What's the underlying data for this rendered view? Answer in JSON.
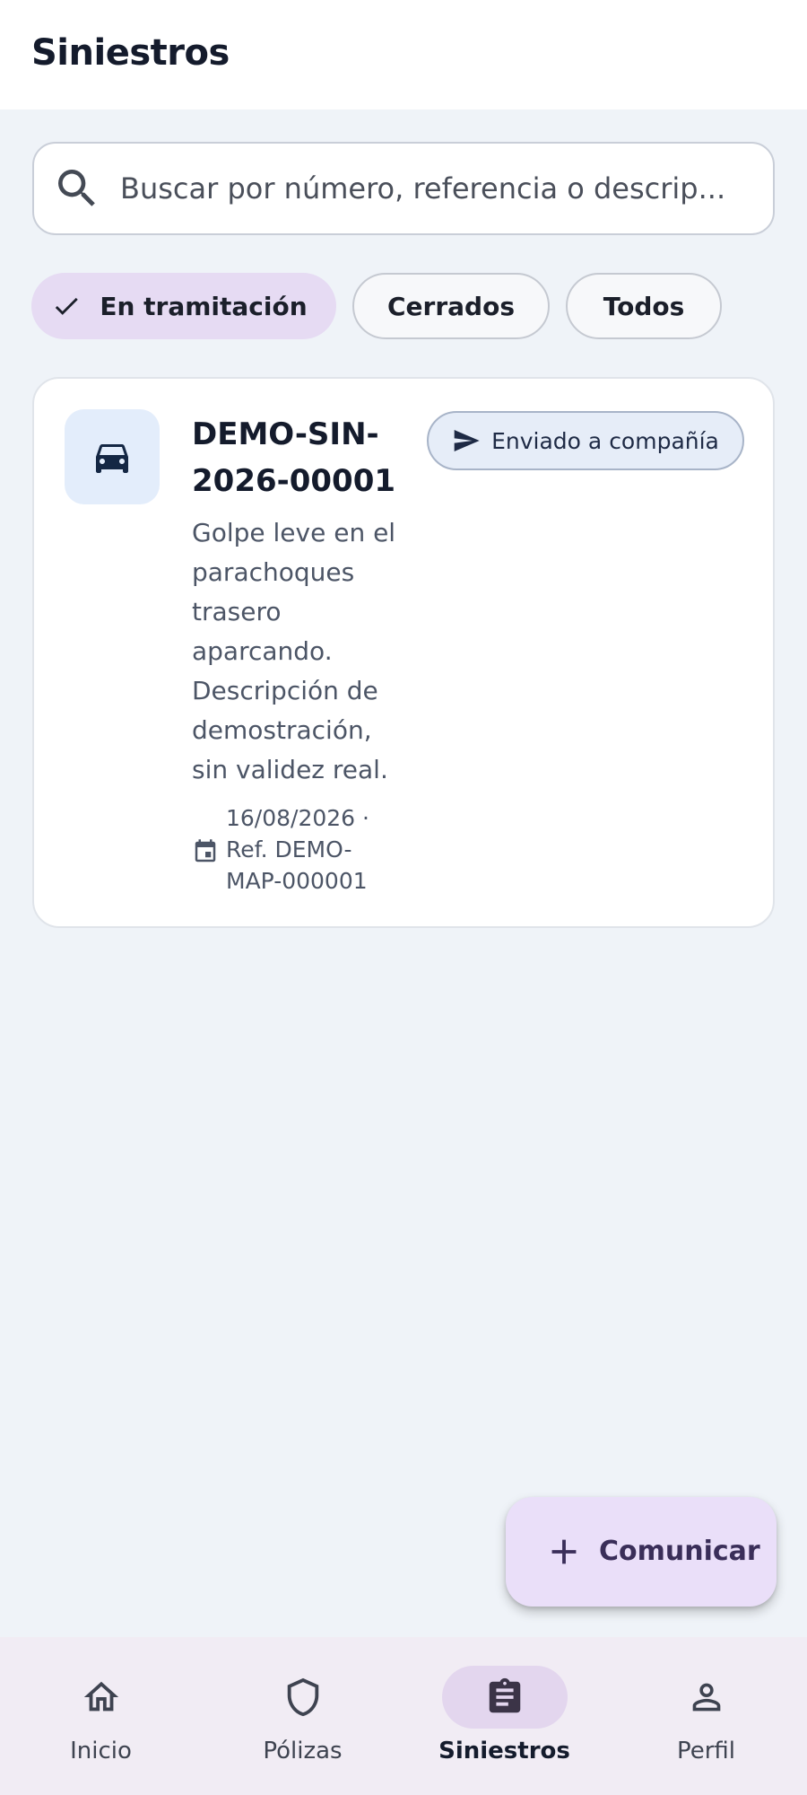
{
  "header": {
    "title": "Siniestros"
  },
  "search": {
    "placeholder": "Buscar por número, referencia o descrip..."
  },
  "filters": [
    {
      "label": "En tramitación",
      "selected": true
    },
    {
      "label": "Cerrados",
      "selected": false
    },
    {
      "label": "Todos",
      "selected": false
    }
  ],
  "claims": [
    {
      "number": "DEMO-SIN-2026-00001",
      "status": "Enviado a compañía",
      "description": "Golpe leve en el parachoques trasero aparcando. Descripción de demostración, sin validez real.",
      "date": "16/08/2026",
      "reference": "Ref. DEMO-MAP-000001",
      "meta": "16/08/2026 · Ref. DEMO-MAP-000001",
      "icon": "car-icon"
    }
  ],
  "fab": {
    "label": "Comunicar",
    "icon": "plus-icon"
  },
  "nav": [
    {
      "label": "Inicio",
      "icon": "home-icon",
      "active": false
    },
    {
      "label": "Pólizas",
      "icon": "shield-icon",
      "active": false
    },
    {
      "label": "Siniestros",
      "icon": "clipboard-icon",
      "active": true
    },
    {
      "label": "Perfil",
      "icon": "person-icon",
      "active": false
    }
  ],
  "colors": {
    "background": "#eff3f8",
    "chip_selected": "#e6dbf3",
    "fab": "#eadff9",
    "nav_background": "#f1ecf4",
    "nav_active": "#e3d6ee",
    "status_badge": "#e6edf8"
  }
}
